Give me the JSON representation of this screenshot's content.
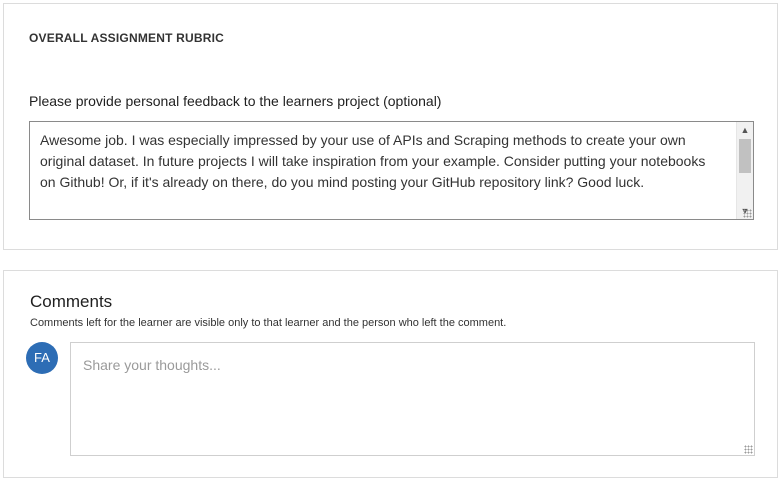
{
  "rubric": {
    "heading": "OVERALL ASSIGNMENT RUBRIC",
    "feedback_label": "Please provide personal feedback to the learners project (optional)",
    "feedback_text": "Awesome job. I was especially impressed by your use of APIs and Scraping methods to create your own original dataset. In future projects I will take inspiration from your example. Consider putting your notebooks on Github! Or, if it's already on there, do you mind posting your GitHub repository link? Good luck."
  },
  "comments": {
    "title": "Comments",
    "subtitle": "Comments left for the learner are visible only to that learner and the person who left the comment.",
    "avatar_initials": "FA",
    "input_placeholder": "Share your thoughts...",
    "input_value": ""
  },
  "icons": {
    "scroll_up": "chevron-up-icon",
    "scroll_down": "chevron-down-icon",
    "resize": "resize-grip-icon"
  },
  "colors": {
    "avatar_bg": "#2d6db5",
    "border": "#dcdcdc",
    "field_border": "#8a8a8a"
  }
}
